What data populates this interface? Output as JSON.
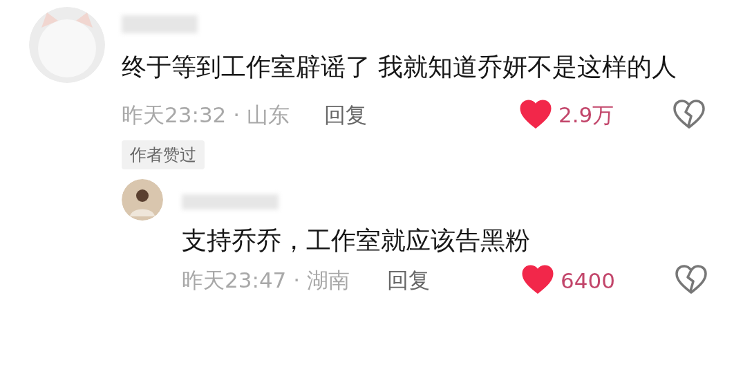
{
  "comments": [
    {
      "text": "终于等到工作室辟谣了  我就知道乔妍不是这样的人",
      "time_location": "昨天23:32 · 山东",
      "reply_label": "回复",
      "liked": true,
      "likes": "2.9万",
      "badge": "作者赞过",
      "replies": [
        {
          "text": "支持乔乔，工作室就应该告黑粉",
          "time_location": "昨天23:47 · 湖南",
          "reply_label": "回复",
          "liked": true,
          "likes": "6400"
        }
      ]
    }
  ]
}
